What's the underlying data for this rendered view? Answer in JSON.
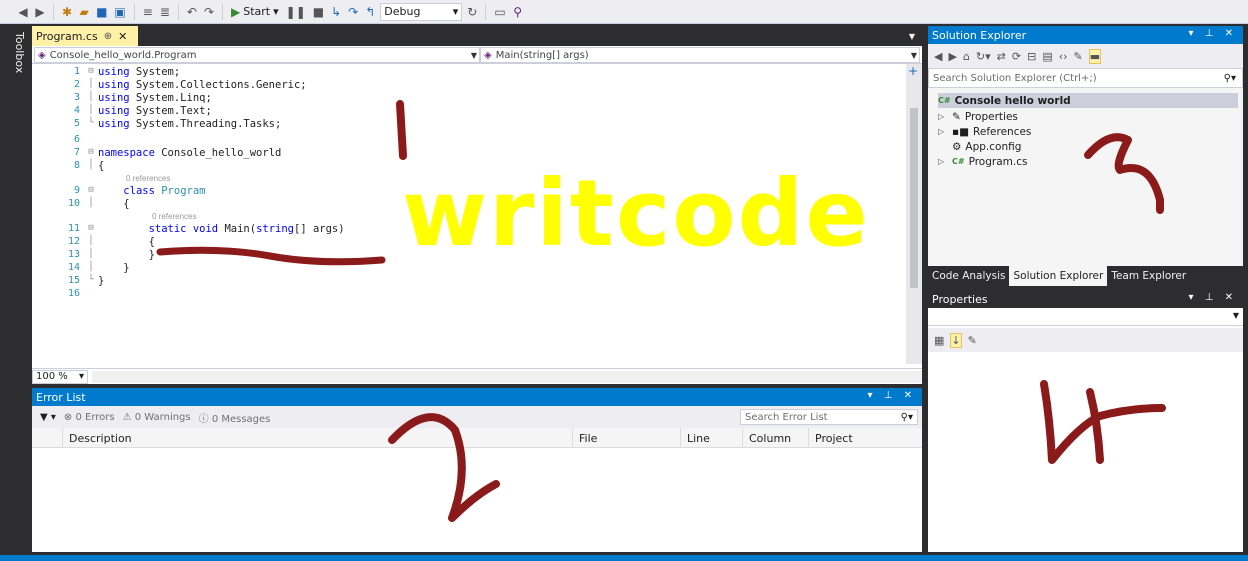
{
  "toolbar": {
    "start_label": "Start",
    "config": "Debug"
  },
  "toolbox": {
    "label": "Toolbox"
  },
  "editor": {
    "tab_label": "Program.cs",
    "tab_pin": "⊕",
    "tab_close": "✕",
    "nav_left": "Console_hello_world.Program",
    "nav_right": "Main(string[] args)",
    "zoom": "100 %",
    "codelens": "0 references",
    "lines": {
      "n1": "1",
      "n2": "2",
      "n3": "3",
      "n4": "4",
      "n5": "5",
      "n6": "6",
      "n7": "7",
      "n8": "8",
      "n9": "9",
      "n10": "10",
      "n11": "11",
      "n12": "12",
      "n13": "13",
      "n14": "14",
      "n15": "15",
      "n16": "16",
      "using": "using",
      "u1": " System;",
      "u2": " System.Collections.Generic;",
      "u3": " System.Linq;",
      "u4": " System.Text;",
      "u5": " System.Threading.Tasks;",
      "namespace_kw": "namespace",
      "namespace_name": " Console_hello_world",
      "open_brace": "{",
      "close_brace": "}",
      "class_kw": "class",
      "class_name": " Program",
      "static_kw": "static",
      "void_kw": " void",
      "main_sig_a": " Main(",
      "string_kw": "string",
      "main_sig_b": "[] args)"
    }
  },
  "error_list": {
    "title": "Error List",
    "filter": "▼ ▾",
    "errors": "0 Errors",
    "warnings": "0 Warnings",
    "messages": "0 Messages",
    "search_placeholder": "Search Error List",
    "columns": {
      "description": "Description",
      "file": "File",
      "line": "Line",
      "column": "Column",
      "project": "Project"
    }
  },
  "solution_explorer": {
    "title": "Solution Explorer",
    "search_placeholder": "Search Solution Explorer (Ctrl+;)",
    "items": {
      "project": "Console hello world",
      "properties": "Properties",
      "references": "References",
      "app_config": "App.config",
      "program_cs": "Program.cs"
    },
    "tabs": {
      "code_analysis": "Code Analysis",
      "solution_explorer": "Solution Explorer",
      "team_explorer": "Team Explorer"
    }
  },
  "properties": {
    "title": "Properties"
  },
  "annotations": {
    "a1": "1",
    "a_writcode": "writcode",
    "a2": "2",
    "a3": "3",
    "a4": "4",
    "color_red": "#8b1a1a",
    "color_yellow": "#ffff00"
  },
  "colors": {
    "accent": "#007acc",
    "chrome": "#2d2d30",
    "tab_active": "#fff1a8"
  }
}
